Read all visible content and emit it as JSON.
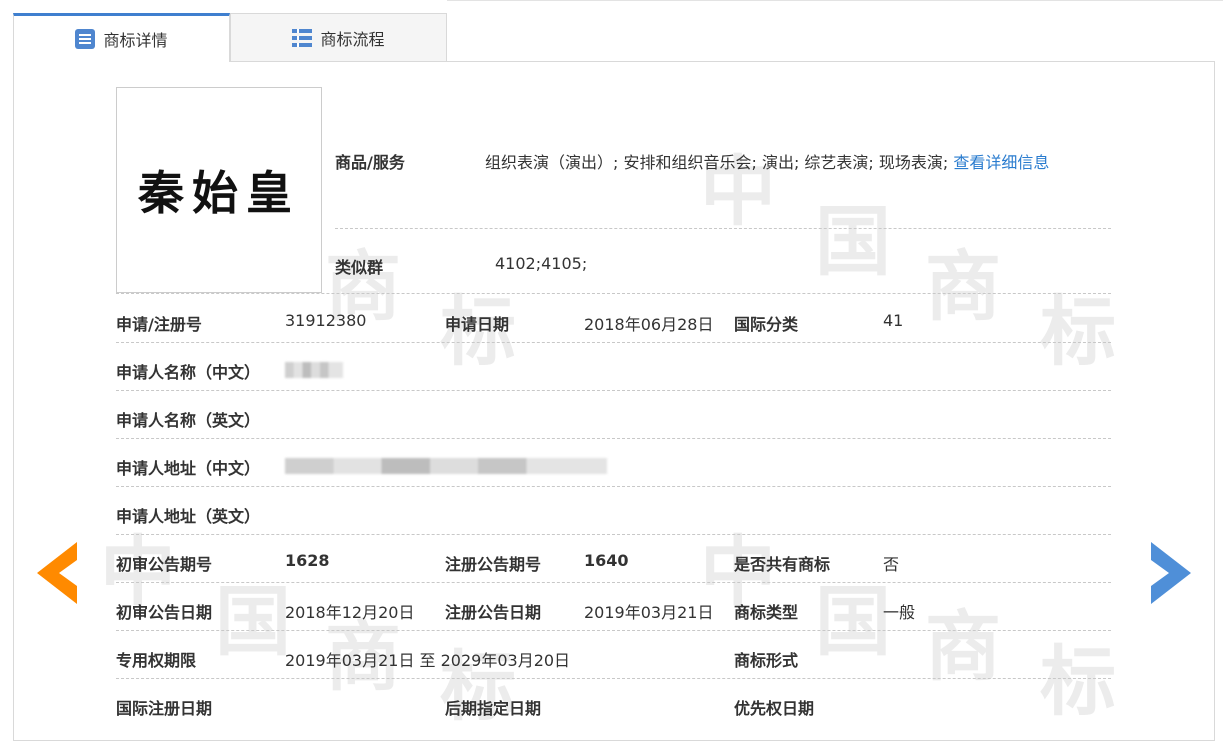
{
  "tabs": [
    {
      "label": "商标详情",
      "icon": "document-list-icon",
      "active": true
    },
    {
      "label": "商标流程",
      "icon": "list-icon",
      "active": false
    }
  ],
  "watermark_chars": [
    "中",
    "国",
    "商",
    "标"
  ],
  "trademark": {
    "image_text": "秦始皇"
  },
  "goods_services": {
    "label": "商品/服务",
    "value": "组织表演（演出）; 安排和组织音乐会; 演出; 综艺表演; 现场表演;",
    "link": "查看详细信息"
  },
  "similar_group": {
    "label": "类似群",
    "value": "4102;4105;"
  },
  "rows": {
    "reg_no": {
      "label": "申请/注册号",
      "value": "31912380"
    },
    "apply_date": {
      "label": "申请日期",
      "value": "2018年06月28日"
    },
    "intl_class": {
      "label": "国际分类",
      "value": "41"
    },
    "applicant_cn": {
      "label": "申请人名称（中文）"
    },
    "applicant_en": {
      "label": "申请人名称（英文）"
    },
    "address_cn": {
      "label": "申请人地址（中文）"
    },
    "address_en": {
      "label": "申请人地址（英文）"
    },
    "prelim_no": {
      "label": "初审公告期号",
      "value": "1628"
    },
    "reg_pub_no": {
      "label": "注册公告期号",
      "value": "1640"
    },
    "shared": {
      "label": "是否共有商标",
      "value": "否"
    },
    "prelim_date": {
      "label": "初审公告日期",
      "value": "2018年12月20日"
    },
    "reg_pub_date": {
      "label": "注册公告日期",
      "value": "2019年03月21日"
    },
    "mark_type": {
      "label": "商标类型",
      "value": "一般"
    },
    "exclusive_period": {
      "label": "专用权期限",
      "value": "2019年03月21日 至 2029年03月20日"
    },
    "mark_form": {
      "label": "商标形式"
    },
    "intl_reg_date": {
      "label": "国际注册日期"
    },
    "later_designation": {
      "label": "后期指定日期"
    },
    "priority_date": {
      "label": "优先权日期"
    }
  },
  "colors": {
    "accent": "#3f7fcf",
    "prev_arrow": "#ff8a00",
    "next_arrow": "#4f8fd8",
    "link": "#2a7ccf"
  }
}
